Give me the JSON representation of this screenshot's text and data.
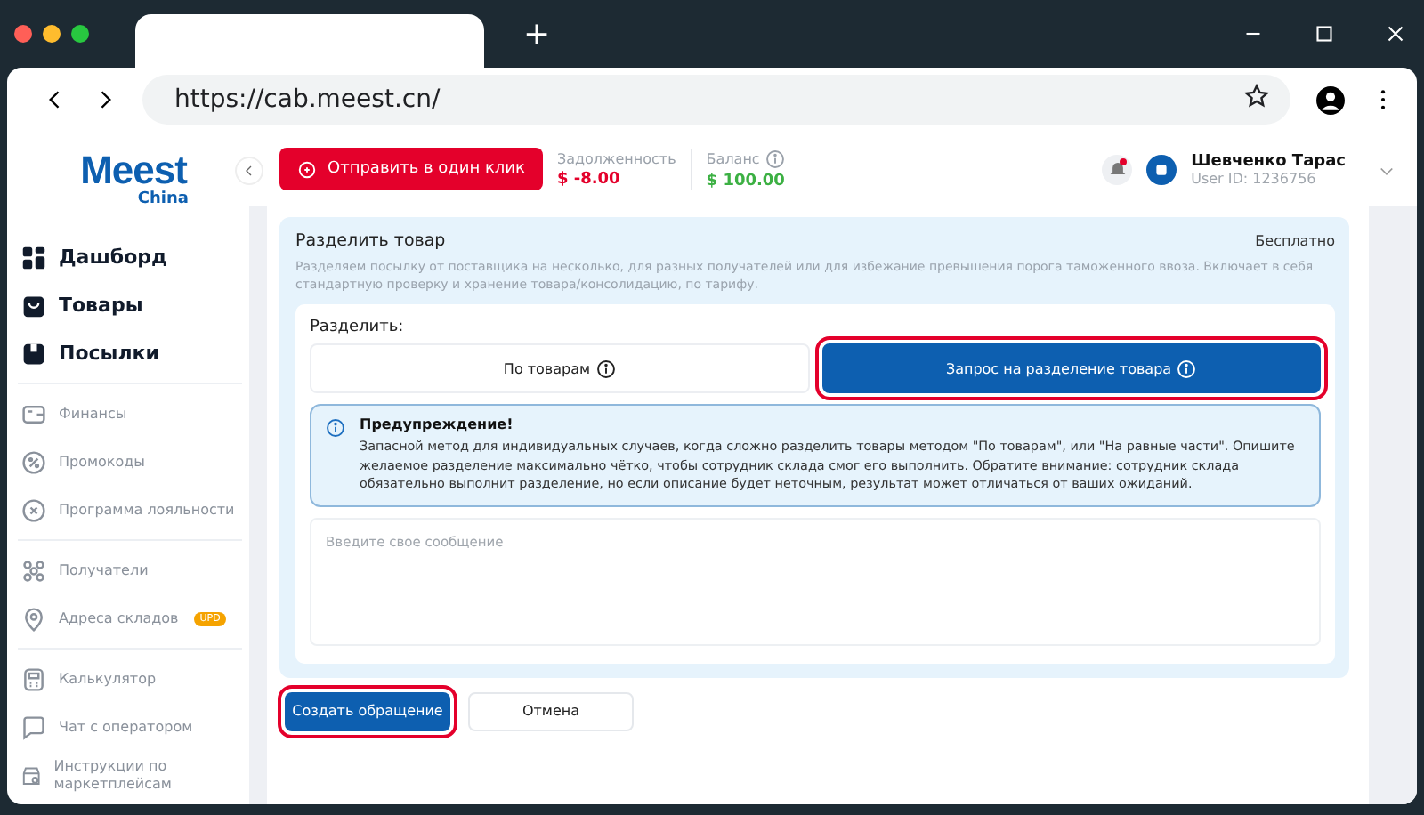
{
  "browser": {
    "url": "https://cab.meest.cn/",
    "new_tab": "+"
  },
  "logo": {
    "name": "Meest",
    "sub": "China"
  },
  "sidebar": {
    "groups": [
      {
        "items": [
          {
            "label": "Дашборд",
            "kind": "main"
          },
          {
            "label": "Товары",
            "kind": "main"
          },
          {
            "label": "Посылки",
            "kind": "main"
          }
        ]
      },
      {
        "items": [
          {
            "label": "Финансы",
            "kind": "sub"
          },
          {
            "label": "Промокоды",
            "kind": "sub"
          },
          {
            "label": "Программа лояльности",
            "kind": "sub"
          }
        ]
      },
      {
        "items": [
          {
            "label": "Получатели",
            "kind": "sub"
          },
          {
            "label": "Адреса складов",
            "kind": "sub",
            "badge": "UPD"
          }
        ]
      },
      {
        "items": [
          {
            "label": "Калькулятор",
            "kind": "sub"
          },
          {
            "label": "Чат с оператором",
            "kind": "sub"
          },
          {
            "label": "Инструкции по маркетплейсам",
            "kind": "sub"
          }
        ]
      }
    ]
  },
  "topbar": {
    "send_button": "Отправить в один клик",
    "stats": [
      {
        "label": "Задолженность",
        "value": "$ -8.00",
        "color": "#e4002b"
      },
      {
        "label": "Баланс",
        "value": "$ 100.00",
        "color": "#3cb043"
      }
    ],
    "notifications_unread": true,
    "user": {
      "name": "Шевченко Тарас",
      "id": "User ID: 1236756"
    }
  },
  "split": {
    "title": "Разделить товар",
    "price": "Бесплатно",
    "description": "Разделяем посылку от поставщика на несколько, для разных получателей или для избежание превышения порога таможенного ввоза. Включает в себя стандартную проверку и хранение товара/консолидацию, по тарифу.",
    "label": "Разделить:",
    "options": [
      {
        "label": "По товарам",
        "selected": false,
        "highlighted": false
      },
      {
        "label": "Запрос на разделение товара",
        "selected": true,
        "highlighted": true
      }
    ],
    "warning": {
      "title": "Предупреждение!",
      "text": "Запасной метод для индивидуальных случаев, когда сложно разделить товары методом \"По товарам\", или \"На равные части\". Опишите желаемое разделение максимально чётко, чтобы сотрудник склада смог его выполнить. Обратите внимание: сотрудник склада обязательно выполнит разделение, но если описание будет неточным, результат может отличаться от ваших ожиданий."
    },
    "message": {
      "placeholder": "Введите свое сообщение"
    }
  },
  "actions": [
    {
      "label": "Создать обращение",
      "kind": "primary",
      "highlighted": true
    },
    {
      "label": "Отмена",
      "kind": "secondary",
      "highlighted": false
    }
  ]
}
